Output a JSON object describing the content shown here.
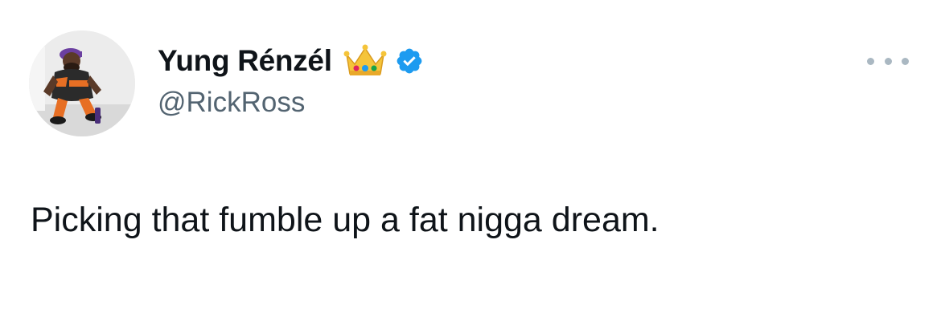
{
  "tweet": {
    "author": {
      "display_name": "Yung Rénzél",
      "handle": "@RickRoss",
      "verified": true,
      "badges": [
        "crown-emoji",
        "verified-badge-icon"
      ],
      "avatar": "profile-photo"
    },
    "text": "Picking that fumble up a fat nigga dream.",
    "more_options_icon": "more-horizontal-icon"
  },
  "colors": {
    "text_primary": "#0f1419",
    "text_secondary": "#536471",
    "verified_blue": "#1d9bf0",
    "more_icon": "#aab8c2",
    "background": "#ffffff"
  }
}
